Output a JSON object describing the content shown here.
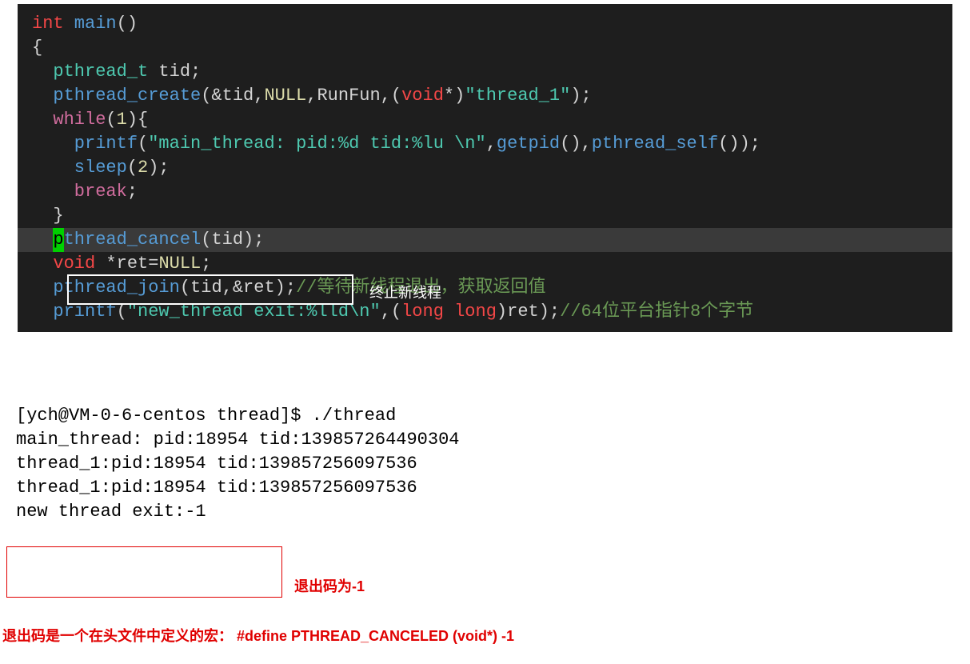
{
  "code": {
    "line1_int": "int",
    "line1_main": " main",
    "line1_paren": "()",
    "line2": "{",
    "line3_type": "  pthread_t",
    "line3_var": " tid;",
    "line4_fn": "  pthread_create",
    "line4_open": "(&tid,",
    "line4_null": "NULL",
    "line4_mid": ",RunFun,(",
    "line4_void": "void",
    "line4_cast": "*)",
    "line4_str": "\"thread_1\"",
    "line4_close": ");",
    "line5": "",
    "line6_while": "  while",
    "line6_open": "(",
    "line6_num": "1",
    "line6_close": "){",
    "line7_fn": "    printf",
    "line7_open": "(",
    "line7_str": "\"main_thread: pid:%d tid:%lu \\n\"",
    "line7_mid": ",",
    "line7_getpid": "getpid",
    "line7_mid2": "(),",
    "line7_self": "pthread_self",
    "line7_close": "());",
    "line8_fn": "    sleep",
    "line8_open": "(",
    "line8_num": "2",
    "line8_close": ");",
    "line9_break": "    break",
    "line9_semi": ";",
    "line10": "  }",
    "line11_indent": "  ",
    "line11_cursor": "p",
    "line11_fn": "thread_cancel",
    "line11_args": "(tid);",
    "line11_label": "终止新线程",
    "line12_void": "  void",
    "line12_rest": " *ret=",
    "line12_null": "NULL",
    "line12_semi": ";",
    "line13_fn": "  pthread_join",
    "line13_args": "(tid,&ret);",
    "line13_comment": "//等待新线程退出，获取返回值",
    "line14_fn": "  printf",
    "line14_open": "(",
    "line14_str": "\"new_thread exit:%lld\\n\"",
    "line14_mid": ",(",
    "line14_long": "long long",
    "line14_close": ")ret);",
    "line14_comment": "//64位平台指针8个字节"
  },
  "terminal": {
    "line1": "[ych@VM-0-6-centos thread]$ ./thread",
    "line2": "main_thread: pid:18954 tid:139857264490304",
    "line3": "thread_1:pid:18954 tid:139857256097536",
    "line4": "thread_1:pid:18954 tid:139857256097536",
    "line5": "new thread exit:-1"
  },
  "annotations": {
    "exit_label": "退出码为-1",
    "bottom_note": "退出码是一个在头文件中定义的宏：  #define PTHREAD_CANCELED (void*) -1"
  }
}
